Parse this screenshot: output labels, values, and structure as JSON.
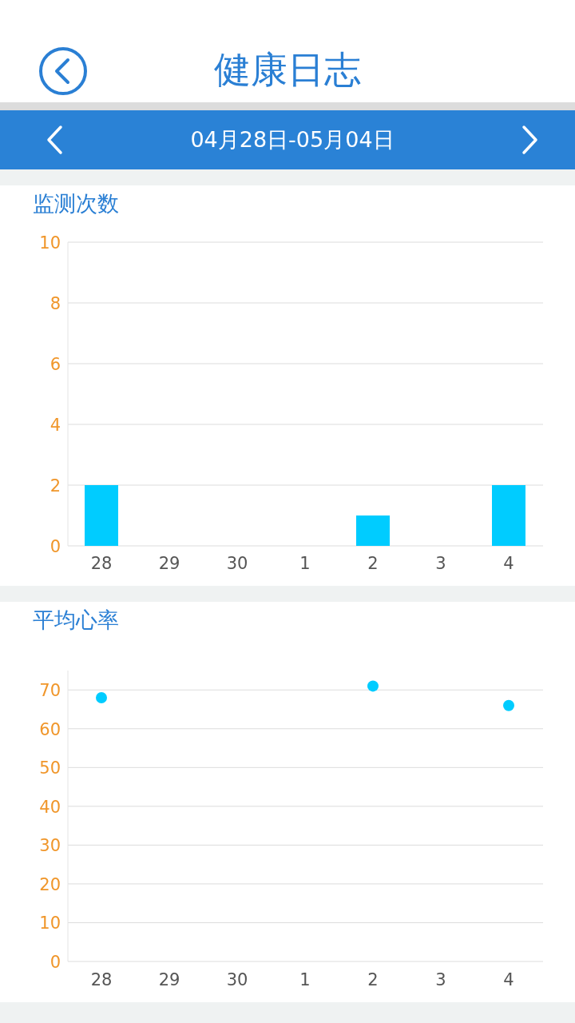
{
  "header": {
    "title": "健康日志"
  },
  "date_bar": {
    "range": "04月28日-05月04日"
  },
  "sections": [
    {
      "title": "监测次数",
      "chart_data": {
        "type": "bar",
        "categories": [
          "28",
          "29",
          "30",
          "1",
          "2",
          "3",
          "4"
        ],
        "series": [
          {
            "color": "#00ccff",
            "values": [
              2,
              0,
              0,
              0,
              1,
              0,
              2
            ]
          }
        ],
        "ylim": [
          0,
          10
        ],
        "yticks": [
          0,
          2,
          4,
          6,
          8,
          10
        ],
        "grid": true
      }
    },
    {
      "title": "平均心率",
      "chart_data": {
        "type": "scatter",
        "categories": [
          "28",
          "29",
          "30",
          "1",
          "2",
          "3",
          "4"
        ],
        "series": [
          {
            "color": "#00ccff",
            "values": [
              68,
              null,
              null,
              null,
              71,
              null,
              66
            ]
          }
        ],
        "ylim": [
          0,
          75
        ],
        "yticks": [
          0,
          10,
          20,
          30,
          40,
          50,
          60,
          70
        ],
        "grid": true
      }
    }
  ]
}
